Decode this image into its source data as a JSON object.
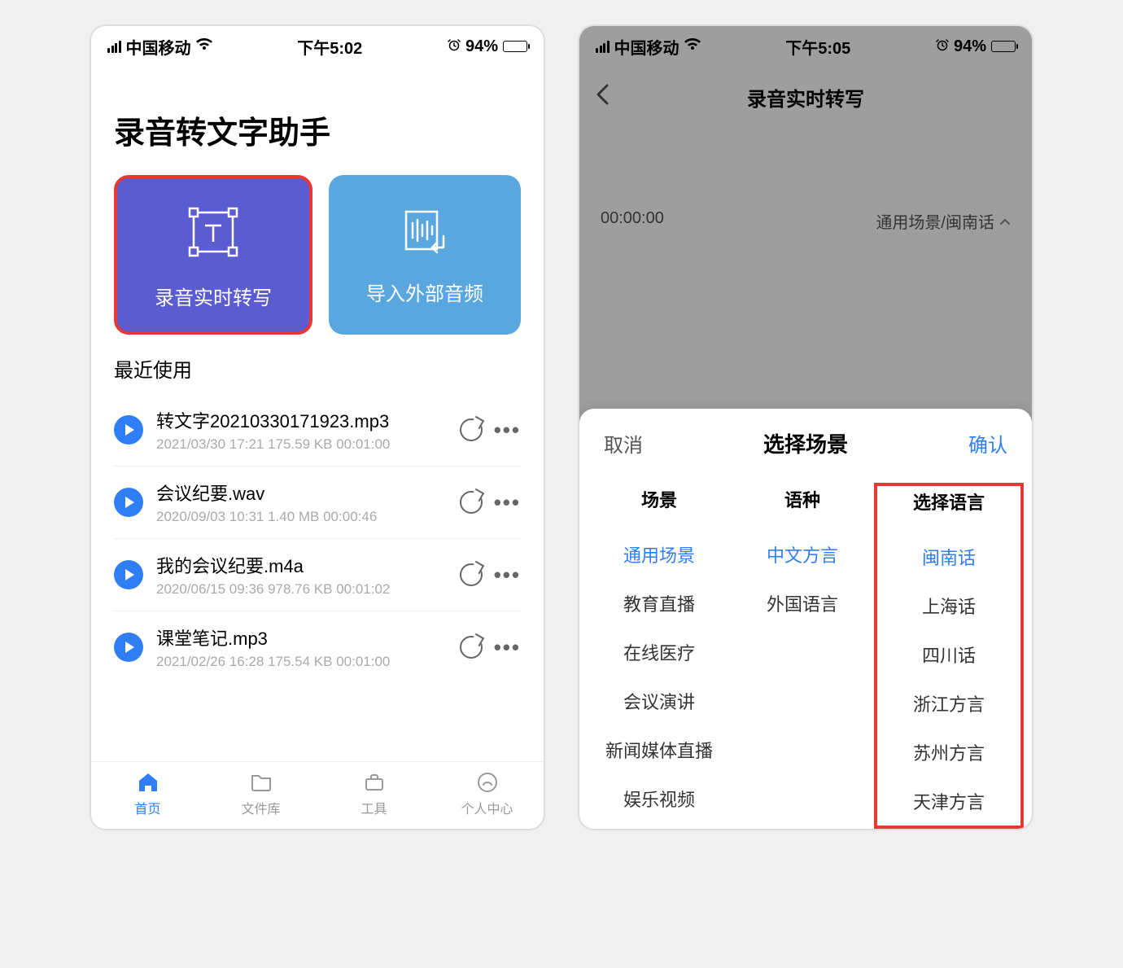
{
  "screen1": {
    "status": {
      "carrier": "中国移动",
      "time": "下午5:02",
      "battery": "94%"
    },
    "app_title": "录音转文字助手",
    "card_realtime": "录音实时转写",
    "card_import": "导入外部音频",
    "recent_label": "最近使用",
    "files": [
      {
        "name": "转文字20210330171923.mp3",
        "meta": "2021/03/30 17:21 175.59 KB  00:01:00"
      },
      {
        "name": "会议纪要.wav",
        "meta": "2020/09/03 10:31 1.40 MB  00:00:46"
      },
      {
        "name": "我的会议纪要.m4a",
        "meta": "2020/06/15 09:36 978.76 KB  00:01:02"
      },
      {
        "name": "课堂笔记.mp3",
        "meta": "2021/02/26 16:28 175.54 KB  00:01:00"
      }
    ],
    "tabs": [
      {
        "label": "首页"
      },
      {
        "label": "文件库"
      },
      {
        "label": "工具"
      },
      {
        "label": "个人中心"
      }
    ]
  },
  "screen2": {
    "status": {
      "carrier": "中国移动",
      "time": "下午5:05",
      "battery": "94%"
    },
    "nav_title": "录音实时转写",
    "timer": "00:00:00",
    "scene_selector": "通用场景/闽南话",
    "sheet": {
      "cancel": "取消",
      "title": "选择场景",
      "confirm": "确认",
      "headers": {
        "scene": "场景",
        "lang": "语种",
        "dialect": "选择语言"
      },
      "col_scene": [
        "通用场景",
        "教育直播",
        "在线医疗",
        "会议演讲",
        "新闻媒体直播",
        "娱乐视频"
      ],
      "col_lang": [
        "中文方言",
        "外国语言"
      ],
      "col_dialect": [
        "闽南话",
        "上海话",
        "四川话",
        "浙江方言",
        "苏州方言",
        "天津方言"
      ],
      "selected": {
        "scene": 0,
        "lang": 0,
        "dialect": 0
      }
    }
  }
}
